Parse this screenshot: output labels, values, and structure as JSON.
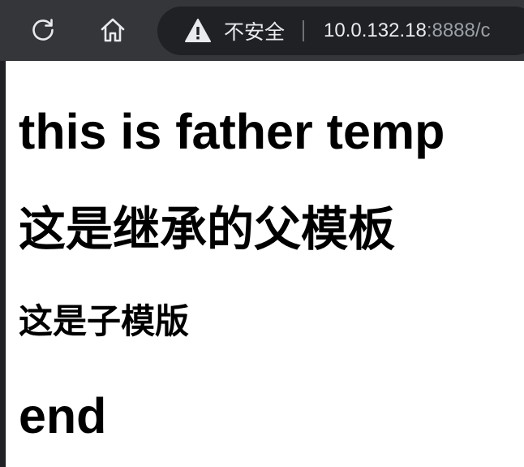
{
  "browser": {
    "reload_icon": "reload-icon",
    "home_icon": "home-icon",
    "security": {
      "icon": "warning-icon",
      "label": "不安全"
    },
    "url": {
      "host": "10.0.132.18",
      "rest": ":8888/c"
    }
  },
  "page": {
    "heading_father": "this is father temp",
    "heading_inherit": "这是继承的父模板",
    "heading_child": "这是子模版",
    "heading_end": "end"
  }
}
